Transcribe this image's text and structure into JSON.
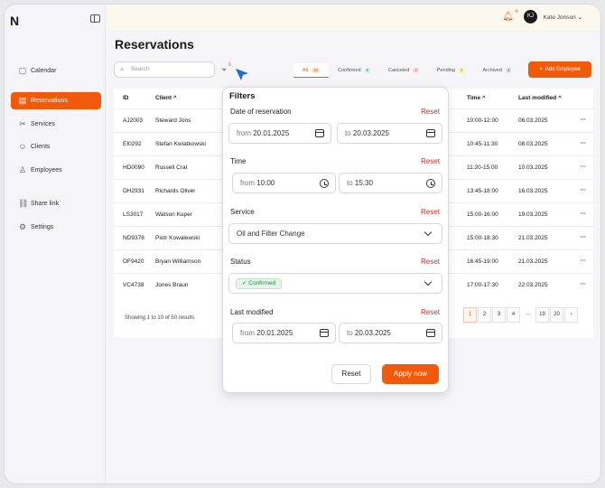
{
  "logo": "N",
  "sidebar": {
    "items": [
      {
        "label": "Calendar",
        "icon": "calendar-icon",
        "glyph": "▢"
      },
      {
        "label": "Reservations",
        "icon": "reservations-icon",
        "glyph": "▤"
      },
      {
        "label": "Services",
        "icon": "tools-icon",
        "glyph": "✂"
      },
      {
        "label": "Clients",
        "icon": "clients-icon",
        "glyph": "☺"
      },
      {
        "label": "Employees",
        "icon": "employees-icon",
        "glyph": "♙"
      },
      {
        "label": "Share link",
        "icon": "link-icon",
        "glyph": "⛓"
      },
      {
        "label": "Settings",
        "icon": "gear-icon",
        "glyph": "⚙"
      }
    ]
  },
  "topbar": {
    "notification_count": "4",
    "avatar_initials": "KJ",
    "user_name": "Kate Jonson"
  },
  "page_title": "Reservations",
  "search": {
    "placeholder": "Search"
  },
  "filter_count": "0",
  "tabs": [
    {
      "label": "All",
      "count": "16",
      "badge_color": "#fde3d3",
      "text_color": "#f15a0a"
    },
    {
      "label": "Confirmed",
      "count": "6",
      "badge_color": "#d9f3df",
      "text_color": "#1e8a3a"
    },
    {
      "label": "Canceled",
      "count": "3",
      "badge_color": "#fcdede",
      "text_color": "#d62b2b"
    },
    {
      "label": "Pending",
      "count": "4",
      "badge_color": "#fdf0c8",
      "text_color": "#b07b00"
    },
    {
      "label": "Archived",
      "count": "3",
      "badge_color": "#e5e5e8",
      "text_color": "#555555"
    }
  ],
  "add_button": "Add Employee",
  "table": {
    "headers": {
      "id": "ID",
      "client": "Client",
      "time": "Time",
      "modified": "Last modified"
    },
    "rows": [
      {
        "id": "AJ2003",
        "client": "Steward Jons",
        "time": "10:00-12:00",
        "modified": "06.03.2025"
      },
      {
        "id": "EI0292",
        "client": "Stefan Kwiatkowski",
        "time": "10:45-11:30",
        "modified": "08.03.2025"
      },
      {
        "id": "HD0090",
        "client": "Russell Crat",
        "time": "11:20-15:00",
        "modified": "10.03.2025"
      },
      {
        "id": "DH2931",
        "client": "Richards Oliver",
        "time": "13:45-18:00",
        "modified": "16.03.2025"
      },
      {
        "id": "LS3017",
        "client": "Watson Kuper",
        "time": "15:00-16:00",
        "modified": "19.03.2025"
      },
      {
        "id": "ND9378",
        "client": "Piotr Kowalewski",
        "time": "15:00-18:30",
        "modified": "21.03.2025"
      },
      {
        "id": "OF9420",
        "client": "Bryan Williamson",
        "time": "16:45-19:00",
        "modified": "21.03.2025"
      },
      {
        "id": "VC4738",
        "client": "Jones Braun",
        "time": "17:00-17:30",
        "modified": "22.03.2025"
      }
    ],
    "more": "···"
  },
  "pagination": {
    "summary": "Showing 1 to 10 of 50 results",
    "pages": [
      "1",
      "2",
      "3",
      "4",
      "...",
      "19",
      "20",
      "›"
    ]
  },
  "filters": {
    "title": "Filters",
    "reset_label": "Reset",
    "date_label": "Date of reservation",
    "date_from_prefix": "from",
    "date_from": "20.01.2025",
    "date_to_prefix": "to",
    "date_to": "20.03.2025",
    "time_label": "Time",
    "time_from_prefix": "from",
    "time_from": "10:00",
    "time_to_prefix": "to",
    "time_to": "15:30",
    "service_label": "Service",
    "service_value": "Oil and Filter Change",
    "status_label": "Status",
    "status_value": "✓ Confirmed",
    "modified_label": "Last modified",
    "mod_from_prefix": "from",
    "mod_from": "20.01.2025",
    "mod_to_prefix": "to",
    "mod_to": "20.03.2025",
    "reset_button": "Reset",
    "apply_button": "Apply now"
  },
  "colors": {
    "accent": "#f15a0a",
    "danger": "#e0231f",
    "success": "#1e8a3a"
  }
}
